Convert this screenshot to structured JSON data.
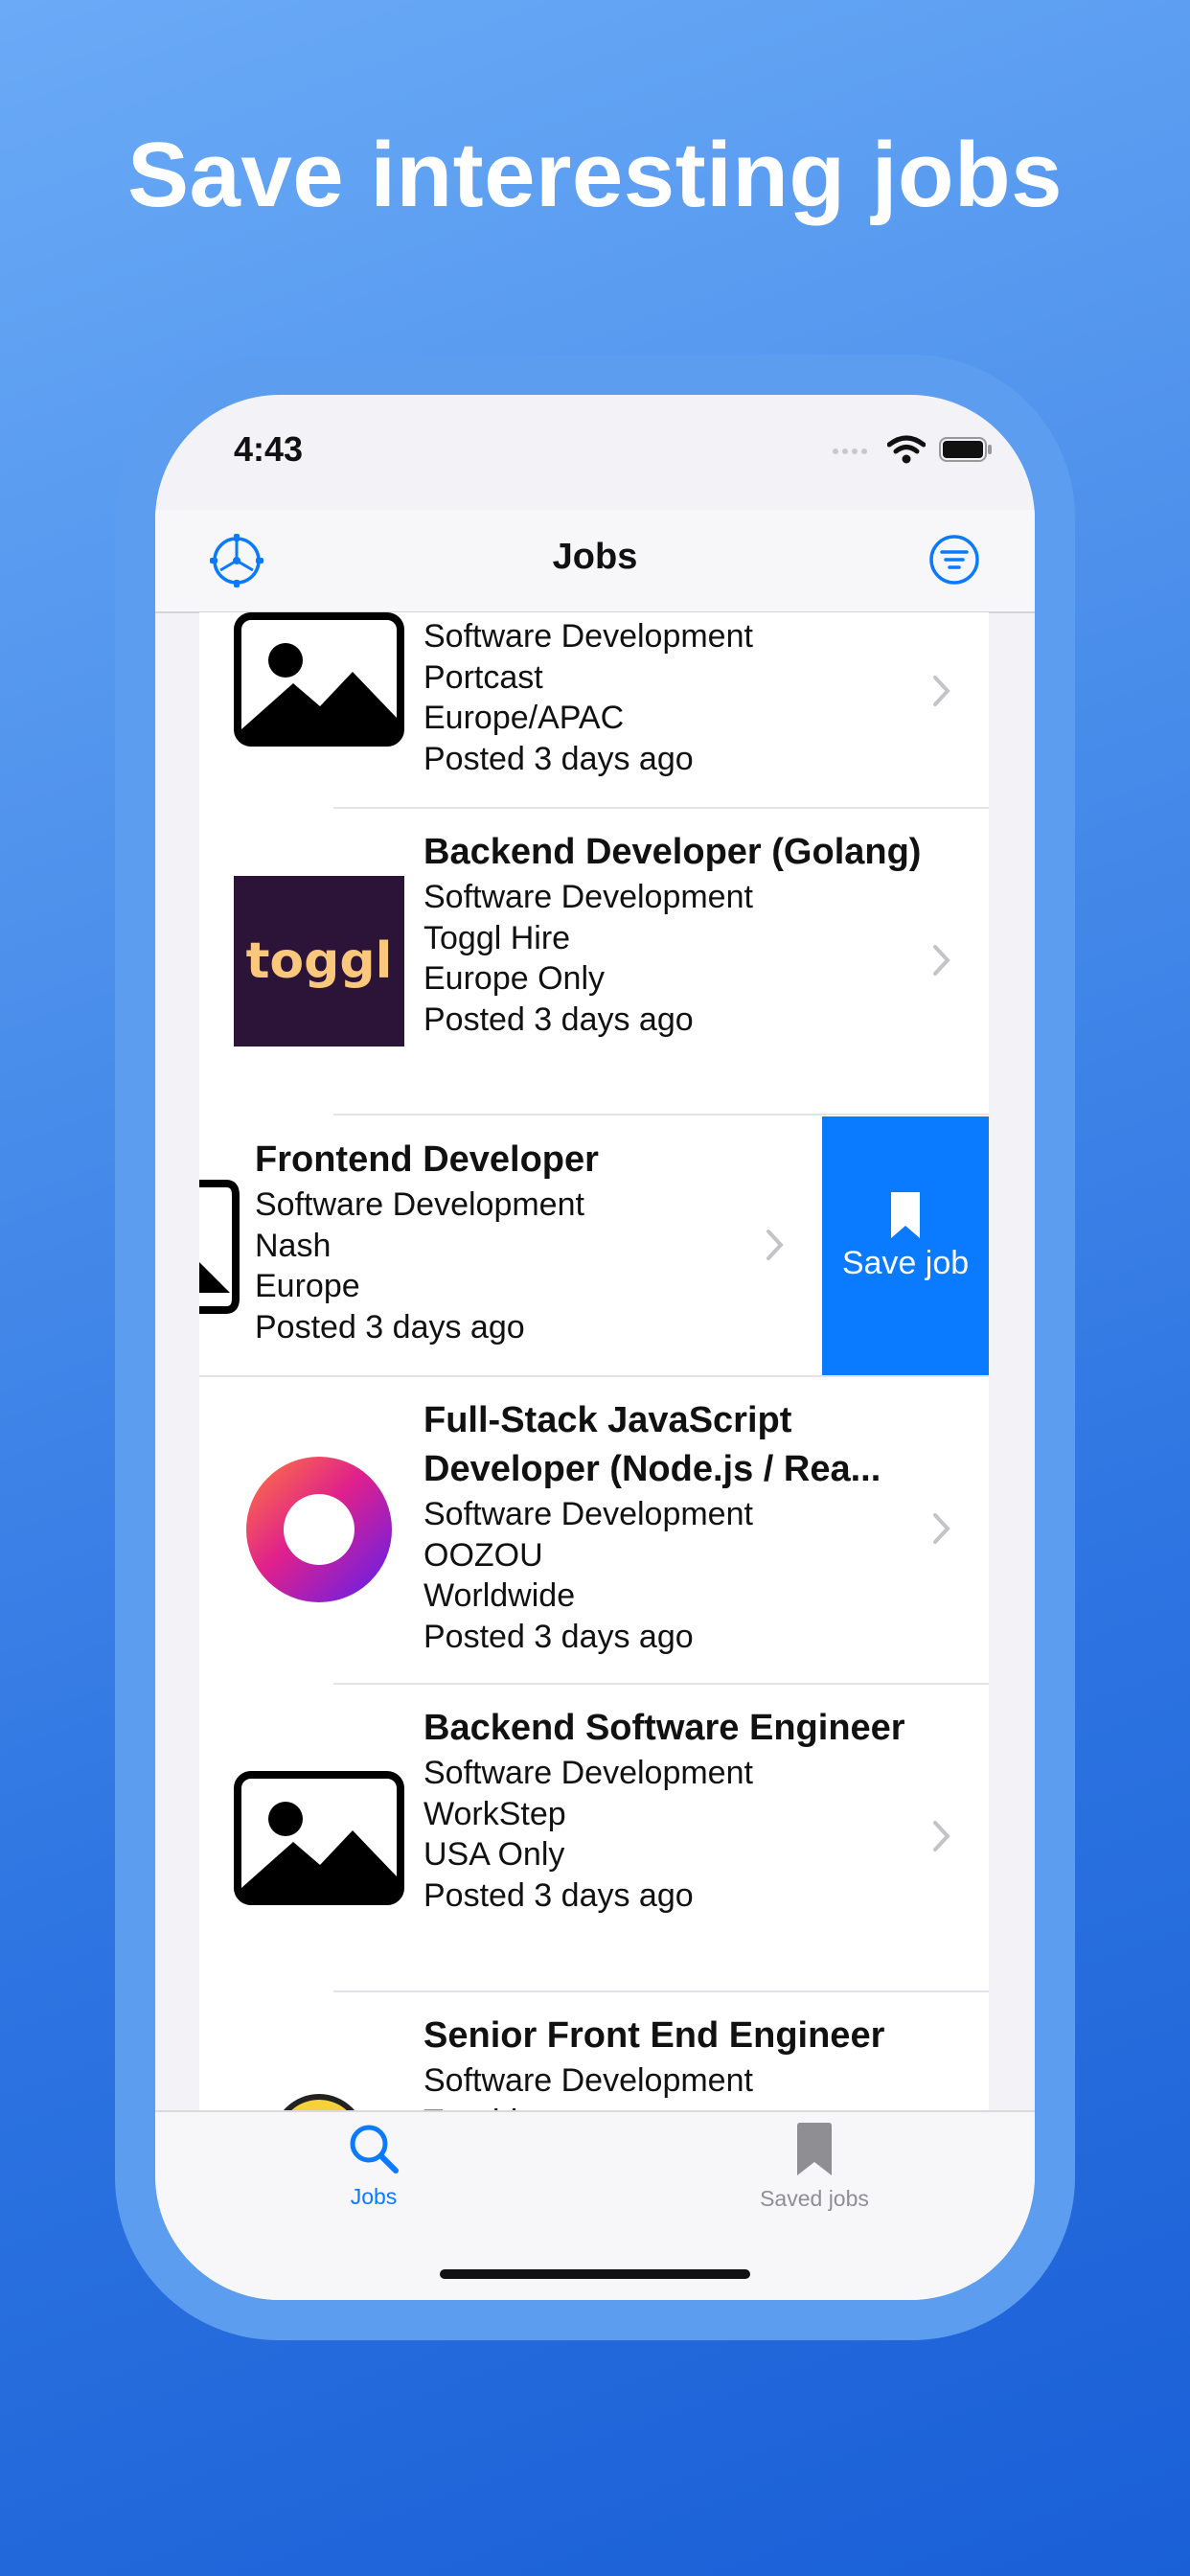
{
  "headline": "Save interesting jobs",
  "status_bar": {
    "time": "4:43"
  },
  "nav": {
    "title": "Jobs",
    "left_icon": "settings-gear-icon",
    "right_icon": "filter-icon"
  },
  "jobs": [
    {
      "title": "",
      "category": "Software Development",
      "company": "Portcast",
      "location": "Europe/APAC",
      "posted": "Posted 3 days ago",
      "logo": "image-placeholder-icon"
    },
    {
      "title": "Backend Developer (Golang)",
      "category": "Software Development",
      "company": "Toggl Hire",
      "location": "Europe Only",
      "posted": "Posted 3 days ago",
      "logo": "toggl",
      "logo_text": "toggl"
    },
    {
      "title": "Frontend Developer",
      "category": "Software Development",
      "company": "Nash",
      "location": "Europe",
      "posted": "Posted 3 days ago",
      "logo": "image-placeholder-icon",
      "swipe_action": "Save job"
    },
    {
      "title": "Full-Stack JavaScript Developer (Node.js / Rea...",
      "category": "Software Development",
      "company": "OOZOU",
      "location": "Worldwide",
      "posted": "Posted 3 days ago",
      "logo": "oozou-ring"
    },
    {
      "title": "Backend Software Engineer",
      "category": "Software Development",
      "company": "WorkStep",
      "location": "USA Only",
      "posted": "Posted 3 days ago",
      "logo": "image-placeholder-icon"
    },
    {
      "title": "Senior Front End Engineer",
      "category": "Software Development",
      "company": "Teaching.com",
      "location": "",
      "posted": "",
      "logo": "teaching-logo"
    }
  ],
  "tabs": [
    {
      "label": "Jobs",
      "icon": "search-icon",
      "active": true
    },
    {
      "label": "Saved jobs",
      "icon": "bookmark-icon",
      "active": false
    }
  ],
  "colors": {
    "accent": "#0A7AFF",
    "inactive_tab": "#8E8E93",
    "toggl_bg": "#2C1338",
    "toggl_text": "#F9C87C"
  }
}
